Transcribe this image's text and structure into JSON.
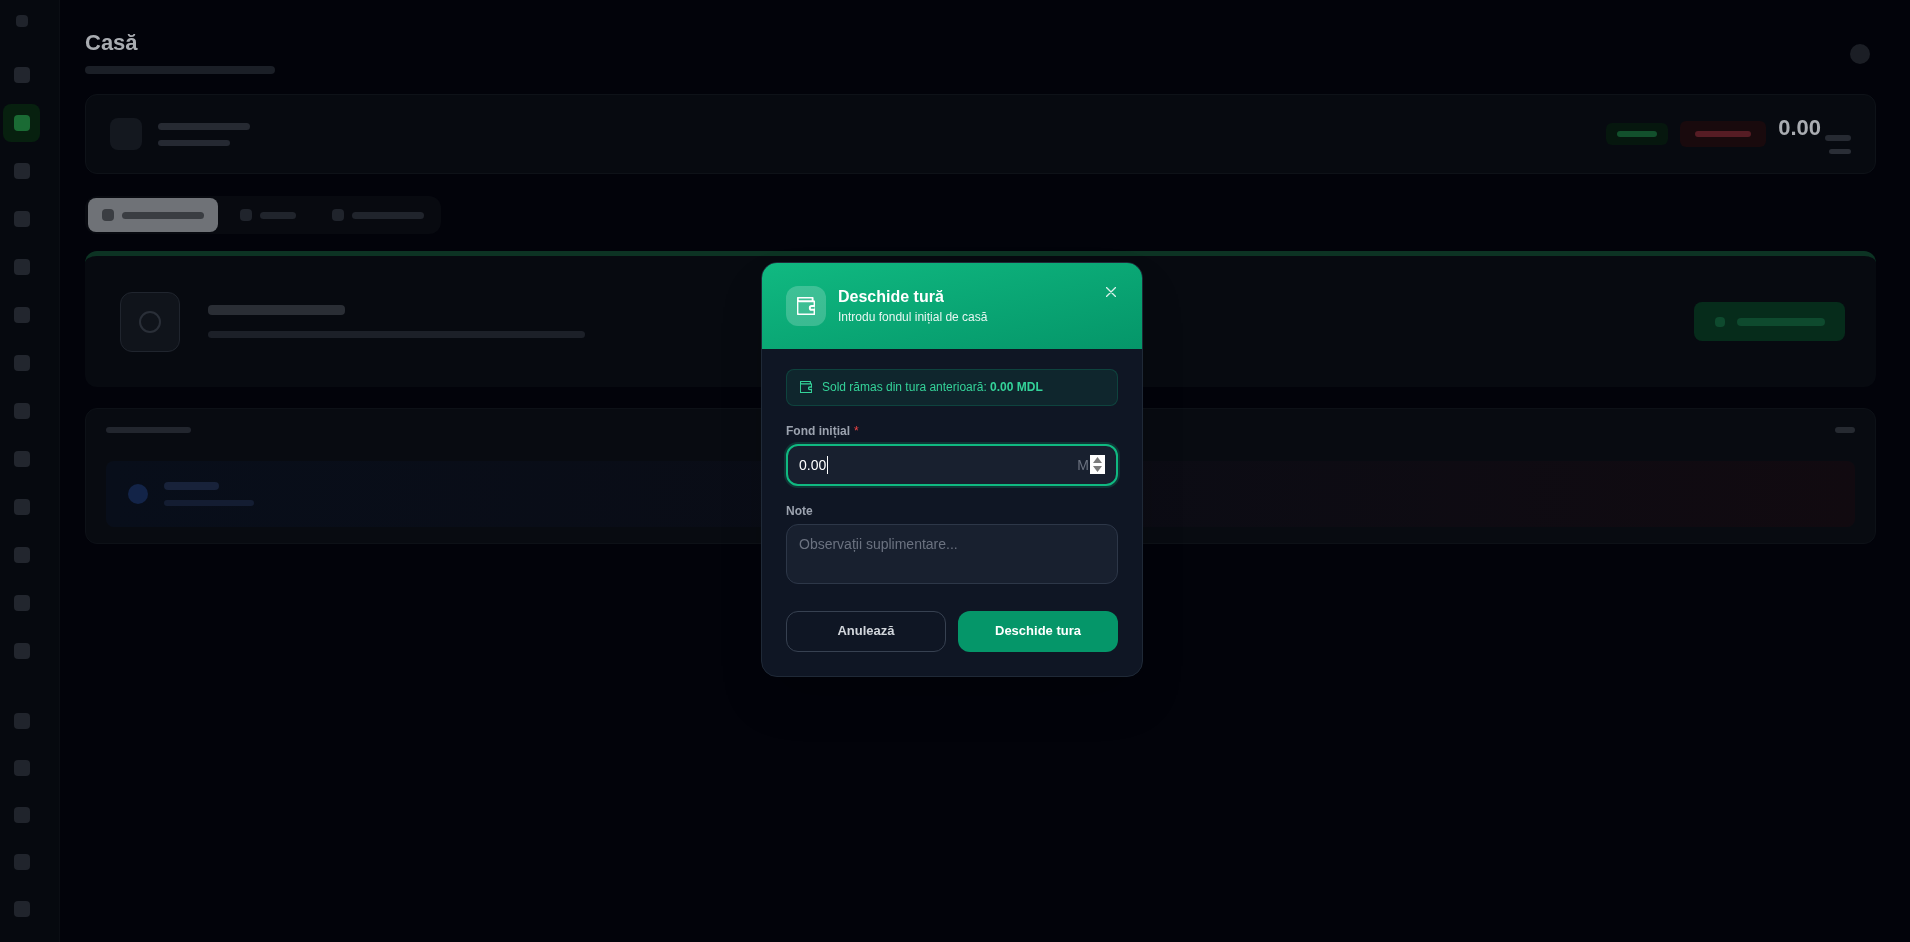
{
  "sidebar": {
    "items": [
      {
        "selected": false
      },
      {
        "selected": true
      },
      {
        "selected": false
      },
      {
        "selected": false
      },
      {
        "selected": false
      },
      {
        "selected": false
      },
      {
        "selected": false
      },
      {
        "selected": false
      },
      {
        "selected": false
      },
      {
        "selected": false
      },
      {
        "selected": false
      },
      {
        "selected": false
      },
      {
        "selected": false
      }
    ]
  },
  "page": {
    "title": "Casă"
  },
  "summary_card": {
    "balance": "0.00"
  },
  "tabs": [
    {
      "selected": true
    },
    {
      "selected": false
    },
    {
      "selected": false
    }
  ],
  "dialog": {
    "title": "Deschide tură",
    "subtitle": "Introdu fondul inițial de casă",
    "notice": "Sold rămas din tura anterioară: **0.00 MDL**",
    "fields": [
      {
        "kind": "amount",
        "label": "Fond inițial",
        "required_mark": "*",
        "value": "0.00",
        "suffix": "M",
        "focused": true
      },
      {
        "kind": "textarea",
        "label": "Note",
        "placeholder": "Observații suplimentare...",
        "focused": false
      }
    ],
    "buttons": [
      {
        "kind": "secondary",
        "label": "Anulează"
      },
      {
        "kind": "primary",
        "label": "Deschide tura"
      }
    ]
  }
}
